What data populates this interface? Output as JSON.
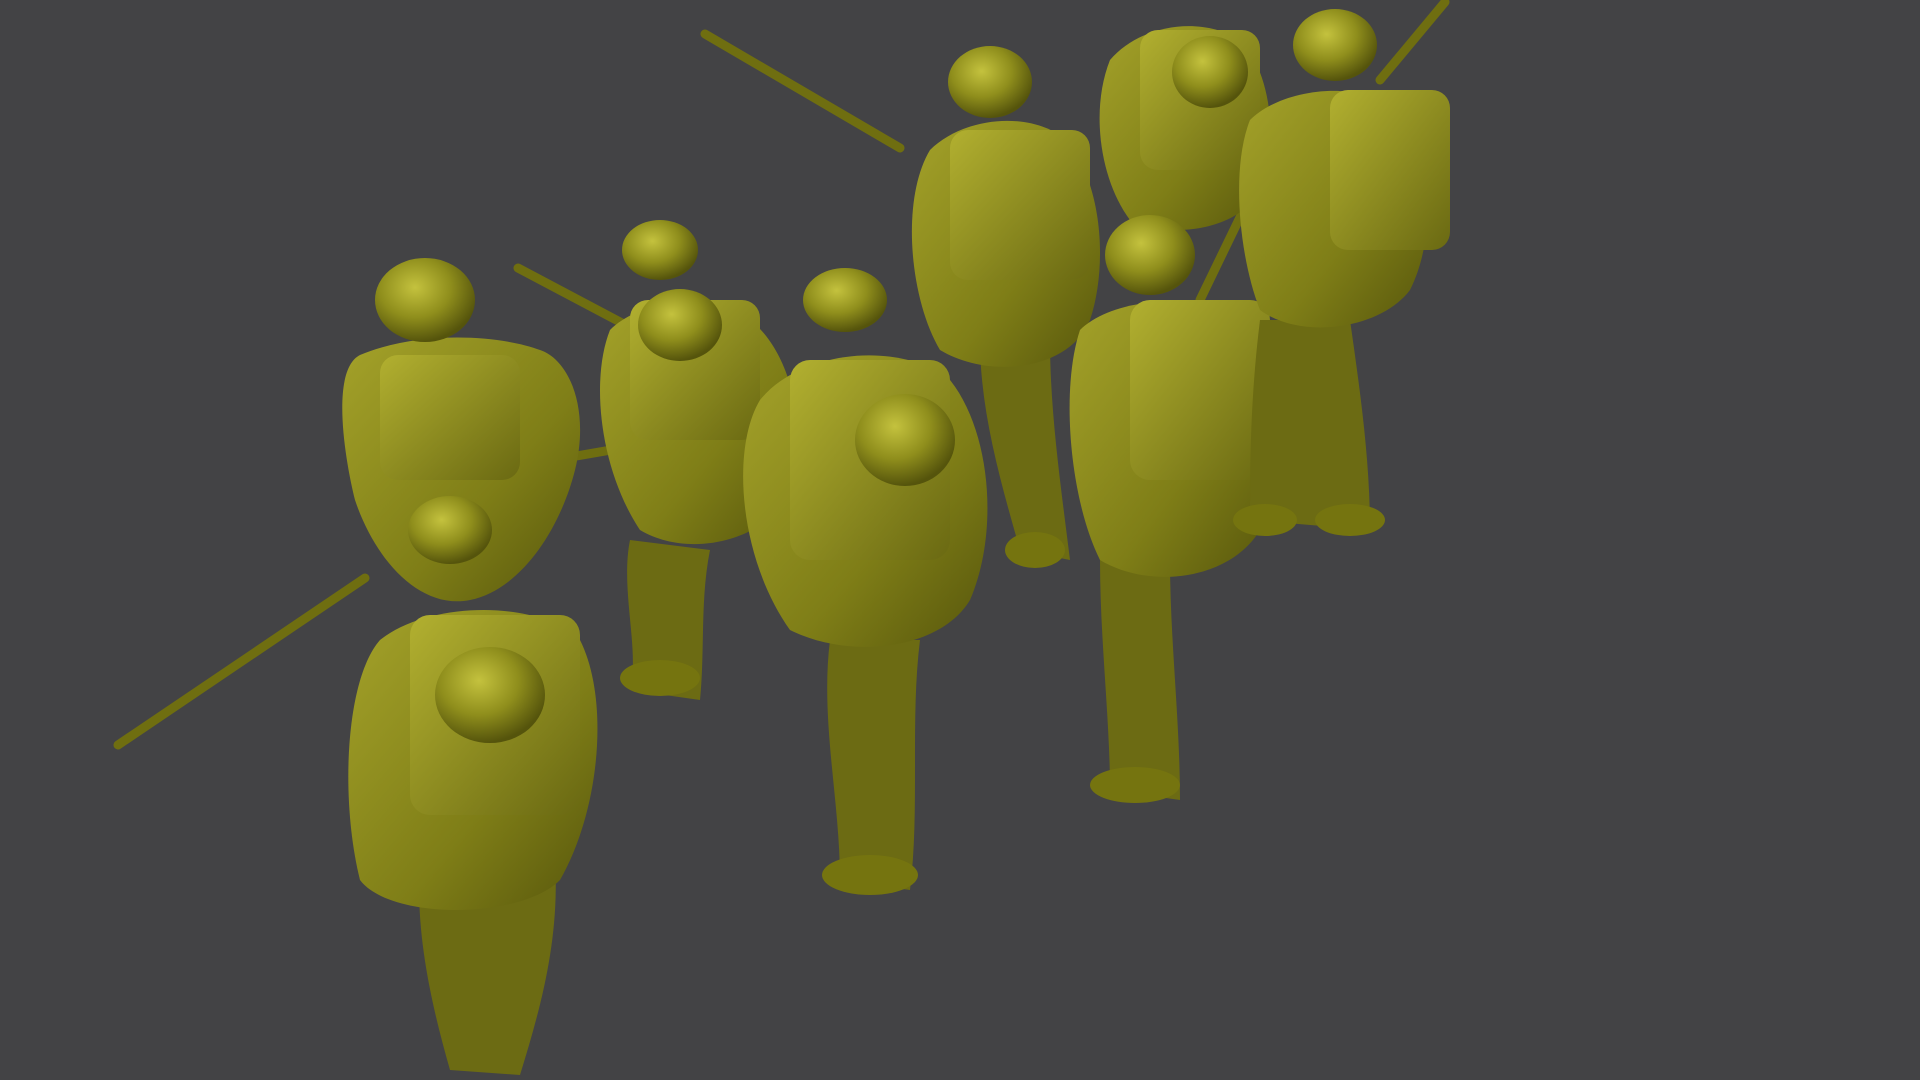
{
  "viewport": {
    "background_color": "#434345"
  },
  "render": {
    "model_color": "#8f8e1c",
    "model_highlight": "#b9b83a",
    "model_shadow": "#4f4e0a",
    "outline_color": "#3a3a06"
  },
  "scene": {
    "subject": "miniature-soldier-figures",
    "figure_count": 9,
    "rifle_count": 6
  }
}
